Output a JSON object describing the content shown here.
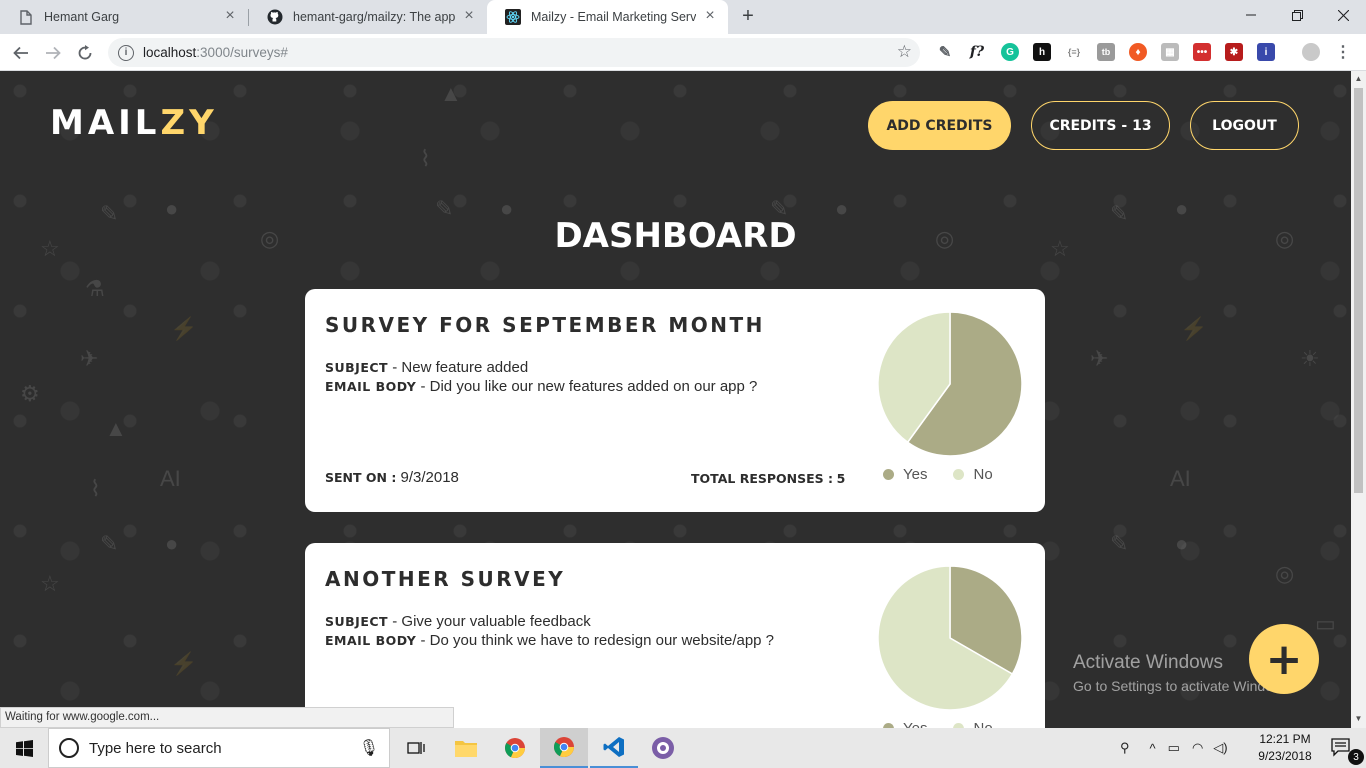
{
  "browser": {
    "tabs": [
      {
        "title": "Hemant Garg",
        "active": false
      },
      {
        "title": "hemant-garg/mailzy: The app tha",
        "active": false
      },
      {
        "title": "Mailzy - Email Marketing Service",
        "active": true
      }
    ],
    "url_host": "localhost",
    "url_path": ":3000/surveys#"
  },
  "header": {
    "logo_main": "MAIL",
    "logo_accent": "ZY",
    "add_credits": "ADD CREDITS",
    "credits": "CREDITS - 13",
    "logout": "LOGOUT"
  },
  "dashboard_title": "DASHBOARD",
  "surveys": [
    {
      "title": "SURVEY FOR SEPTEMBER MONTH",
      "subject_label": "SUBJECT",
      "subject": "New feature added",
      "body_label": "EMAIL BODY",
      "body": "Did you like our new features added on our app ?",
      "sent_label": "SENT ON :",
      "sent_on": "9/3/2018",
      "total_label": "TOTAL RESPONSES :",
      "total_responses": "5",
      "legend_yes": "Yes",
      "legend_no": "No"
    },
    {
      "title": "ANOTHER SURVEY",
      "subject_label": "SUBJECT",
      "subject": "Give your valuable feedback",
      "body_label": "EMAIL BODY",
      "body": "Do you think we have to redesign our website/app ?",
      "legend_yes": "Yes",
      "legend_no": "No"
    }
  ],
  "chart_data": [
    {
      "type": "pie",
      "categories": [
        "Yes",
        "No"
      ],
      "values": [
        3,
        2
      ],
      "colors": [
        "#abab86",
        "#dde5c6"
      ]
    },
    {
      "type": "pie",
      "categories": [
        "Yes",
        "No"
      ],
      "values": [
        1,
        2
      ],
      "colors": [
        "#abab86",
        "#dde5c6"
      ]
    }
  ],
  "watermark": {
    "line1": "Activate Windows",
    "line2": "Go to Settings to activate Windows."
  },
  "status_text": "Waiting for www.google.com...",
  "taskbar": {
    "search_placeholder": "Type here to search",
    "time": "12:21 PM",
    "date": "9/23/2018",
    "notifications": "3"
  },
  "colors": {
    "accent": "#ffd66b",
    "background": "#2e2e2e"
  }
}
